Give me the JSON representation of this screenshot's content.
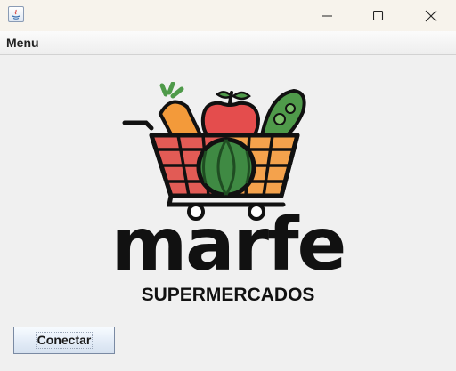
{
  "window": {
    "icon": "java-app-icon",
    "controls": [
      "minimize-icon",
      "maximize-icon",
      "close-icon"
    ]
  },
  "menubar": {
    "items": [
      {
        "label": "Menu"
      }
    ]
  },
  "logo": {
    "brand": "marfe",
    "tagline": "SUPERMERCADOS",
    "colors": {
      "ink": "#111111",
      "cart_red": "#e25b55",
      "cart_orange": "#f4a24c",
      "apple": "#e44d4d",
      "carrot": "#f39a3a",
      "greens": "#4f9a4a"
    }
  },
  "actions": {
    "connect_label": "Conectar"
  }
}
